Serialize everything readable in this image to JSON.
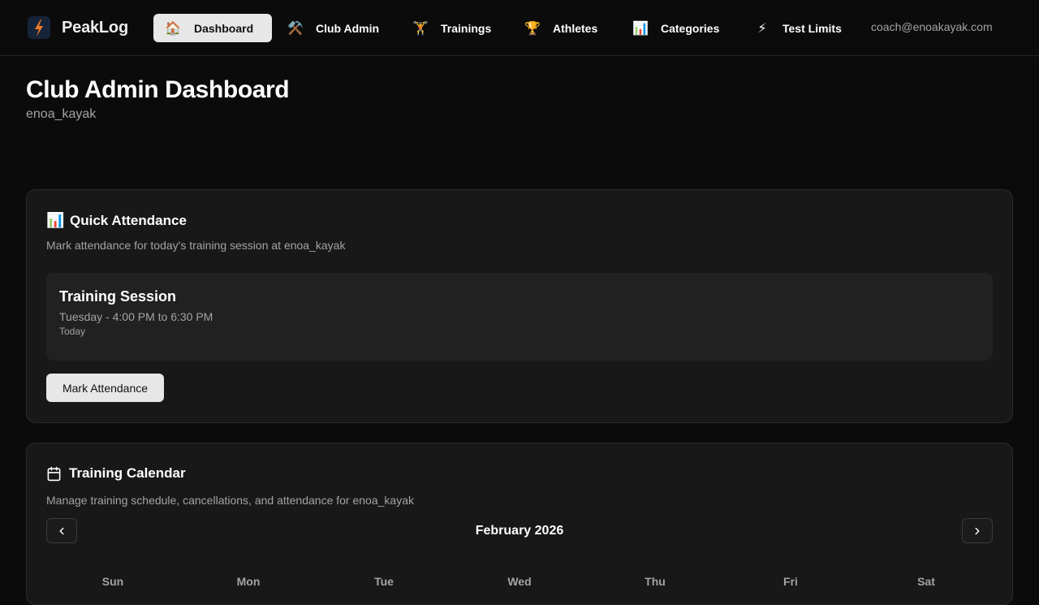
{
  "brand": {
    "name": "PeakLog"
  },
  "nav": {
    "items": [
      {
        "label": "Dashboard",
        "emoji": "🏠",
        "active": true
      },
      {
        "label": "Club Admin",
        "emoji": "⚒️"
      },
      {
        "label": "Trainings",
        "emoji": "🏋️"
      },
      {
        "label": "Athletes",
        "emoji": "🏆"
      },
      {
        "label": "Categories",
        "emoji": "📊"
      },
      {
        "label": "Test Limits",
        "emoji": "⚡"
      }
    ],
    "user_email": "coach@enoakayak.com"
  },
  "page": {
    "title": "Club Admin Dashboard",
    "subtitle": "enoa_kayak"
  },
  "quick_attendance": {
    "icon": "📊",
    "title": "Quick Attendance",
    "description": "Mark attendance for today's training session at enoa_kayak",
    "session": {
      "title": "Training Session",
      "time": "Tuesday - 4:00 PM to 6:30 PM",
      "day": "Today"
    },
    "button_label": "Mark Attendance"
  },
  "calendar": {
    "title": "Training Calendar",
    "description": "Manage training schedule, cancellations, and attendance for enoa_kayak",
    "month": "February 2026",
    "weekdays": [
      "Sun",
      "Mon",
      "Tue",
      "Wed",
      "Thu",
      "Fri",
      "Sat"
    ]
  },
  "colors": {
    "background": "#0b0b0b",
    "card": "#181818",
    "muted_text": "#a3a3a3",
    "active_pill": "#e7e7e7"
  }
}
